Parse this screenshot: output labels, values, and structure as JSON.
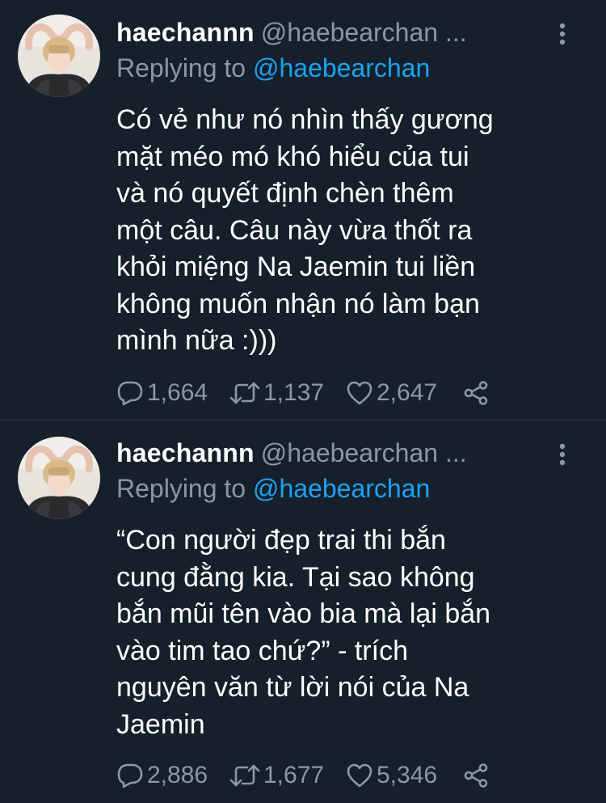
{
  "colors": {
    "background": "#15202b",
    "text": "#ffffff",
    "secondary": "#8899a6",
    "link": "#1da1f2",
    "divider": "#38444d"
  },
  "tweets": [
    {
      "name": "haechannn",
      "handle": "@haebearchan ...",
      "replying_prefix": "Replying to",
      "replying_to": "@haebearchan",
      "text_lines": [
        "Có vẻ như nó nhìn thấy gương",
        "mặt méo mó khó hiểu của tui",
        "và nó quyết định chèn thêm",
        "một câu. Câu này vừa thốt ra",
        "khỏi miệng Na Jaemin tui liền",
        "không muốn nhận nó làm bạn",
        "mình nữa :)))"
      ],
      "replies": "1,664",
      "retweets": "1,137",
      "likes": "2,647"
    },
    {
      "name": "haechannn",
      "handle": "@haebearchan ...",
      "replying_prefix": "Replying to",
      "replying_to": "@haebearchan",
      "text_lines": [
        "“Con người đẹp trai thi bắn",
        "cung đằng kia. Tại sao không",
        "bắn mũi tên vào bia mà lại bắn",
        "vào tim tao chứ?” - trích",
        "nguyên văn từ lời nói của Na",
        "Jaemin"
      ],
      "replies": "2,886",
      "retweets": "1,677",
      "likes": "5,346"
    }
  ],
  "icons": {
    "avatar": "profile-photo",
    "more": "vertical-ellipsis-icon",
    "reply": "speech-bubble-icon",
    "retweet": "retweet-arrows-icon",
    "like": "heart-icon",
    "share": "share-icon"
  }
}
